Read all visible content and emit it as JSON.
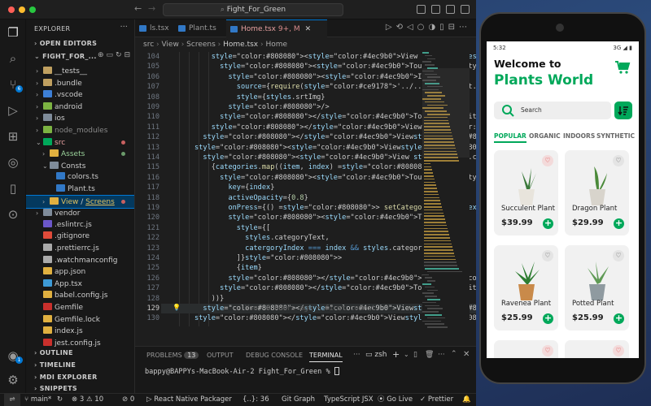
{
  "vscode": {
    "title_search": "Fight_For_Green",
    "explorer_label": "EXPLORER",
    "open_editors": "OPEN EDITORS",
    "project": "FIGHT_FOR_...",
    "tree": [
      {
        "label": "__tests__",
        "depth": 1,
        "chev": "›",
        "color": "#c0a060"
      },
      {
        "label": ".bundle",
        "depth": 1,
        "chev": "›",
        "color": "#c0a060"
      },
      {
        "label": ".vscode",
        "depth": 1,
        "chev": "›",
        "color": "#3d7fd6"
      },
      {
        "label": "android",
        "depth": 1,
        "chev": "›",
        "color": "#7cb342"
      },
      {
        "label": "ios",
        "depth": 1,
        "chev": "›",
        "color": "#7f8c9a"
      },
      {
        "label": "node_modules",
        "depth": 1,
        "chev": "›",
        "color": "#7cb342",
        "dim": true
      },
      {
        "label": "src",
        "depth": 1,
        "chev": "⌄",
        "color": "#00a85a",
        "dot": "#c96060",
        "labelcolor": "#e6a0a0"
      },
      {
        "label": "Assets",
        "depth": 2,
        "chev": "›",
        "color": "#e0b040",
        "dot": "#6a9a6a",
        "labelcolor": "#9ad29a"
      },
      {
        "label": "Consts",
        "depth": 2,
        "chev": "⌄",
        "color": "#7f8c9a"
      },
      {
        "label": "colors.ts",
        "depth": 3,
        "chev": "",
        "color": "#3178c6"
      },
      {
        "label": "Plant.ts",
        "depth": 3,
        "chev": "",
        "color": "#3178c6"
      },
      {
        "label": "View / Screens",
        "depth": 2,
        "chev": "›",
        "color": "#e0b040",
        "dot": "#c96060",
        "selected": true
      },
      {
        "label": "vendor",
        "depth": 1,
        "chev": "›",
        "color": "#7f8c9a"
      },
      {
        "label": ".eslintrc.js",
        "depth": 1,
        "chev": "",
        "color": "#6b57c9"
      },
      {
        "label": ".gitignore",
        "depth": 1,
        "chev": "",
        "color": "#e04b3a"
      },
      {
        "label": ".prettierrc.js",
        "depth": 1,
        "chev": "",
        "color": "#aaaaaa"
      },
      {
        "label": ".watchmanconfig",
        "depth": 1,
        "chev": "",
        "color": "#aaaaaa"
      },
      {
        "label": "app.json",
        "depth": 1,
        "chev": "",
        "color": "#e0b040"
      },
      {
        "label": "App.tsx",
        "depth": 1,
        "chev": "",
        "color": "#3d9ad6"
      },
      {
        "label": "babel.config.js",
        "depth": 1,
        "chev": "",
        "color": "#e0b040"
      },
      {
        "label": "Gemfile",
        "depth": 1,
        "chev": "",
        "color": "#c9302c"
      },
      {
        "label": "Gemfile.lock",
        "depth": 1,
        "chev": "",
        "color": "#e0b040"
      },
      {
        "label": "index.js",
        "depth": 1,
        "chev": "",
        "color": "#e0b040"
      },
      {
        "label": "jest.config.js",
        "depth": 1,
        "chev": "",
        "color": "#c9302c"
      }
    ],
    "outline": "OUTLINE",
    "timeline": "TIMELINE",
    "mdi": "MDI EXPLORER",
    "snippets": "SNIPPETS",
    "tabs": [
      {
        "label": "ls.tsx",
        "active": false
      },
      {
        "label": "Plant.ts",
        "active": false
      },
      {
        "label": "Home.tsx",
        "active": true,
        "badge": "9+, M"
      }
    ],
    "breadcrumb": [
      "src",
      "View",
      "Screens",
      "Home.tsx",
      "Home"
    ],
    "code": [
      {
        "n": "104",
        "t": "          <View style={styles.sortBtn}>"
      },
      {
        "n": "105",
        "t": "            <TouchableOpacity>"
      },
      {
        "n": "106",
        "t": "              <Image"
      },
      {
        "n": "107",
        "t": "                source={require('../../Assets/sort.png')}"
      },
      {
        "n": "108",
        "t": "                style={styles.srtImg}"
      },
      {
        "n": "109",
        "t": "              />"
      },
      {
        "n": "110",
        "t": "            </TouchableOpacity>"
      },
      {
        "n": "111",
        "t": "          </View>"
      },
      {
        "n": "112",
        "t": "        </View>"
      },
      {
        "n": "113",
        "t": "      <View>"
      },
      {
        "n": "114",
        "t": "        <View style={styles.categoryContainer}>"
      },
      {
        "n": "115",
        "t": "          {categories.map((item, index) => ("
      },
      {
        "n": "116",
        "t": "            <TouchableOpacity"
      },
      {
        "n": "117",
        "t": "              key={index}"
      },
      {
        "n": "118",
        "t": "              activeOpacity={0.8}"
      },
      {
        "n": "119",
        "t": "              onPress={() => setCategoryIndex(index)}>"
      },
      {
        "n": "120",
        "t": "              <Text"
      },
      {
        "n": "121",
        "t": "                style={["
      },
      {
        "n": "122",
        "t": "                  styles.categoryText,"
      },
      {
        "n": "123",
        "t": "                  catergoryIndex === index && styles.categoryTextSe"
      },
      {
        "n": "124",
        "t": "                ]}>"
      },
      {
        "n": "125",
        "t": "                {item}"
      },
      {
        "n": "126",
        "t": "              </Text>"
      },
      {
        "n": "127",
        "t": "            </TouchableOpacity>"
      },
      {
        "n": "128",
        "t": "          ))}"
      },
      {
        "n": "129",
        "t": "        </View>",
        "blame": "You, 8 hours ago • first commit"
      },
      {
        "n": "130",
        "t": "      </View>"
      }
    ],
    "panel_tabs": [
      {
        "label": "PROBLEMS",
        "badge": "13"
      },
      {
        "label": "OUTPUT"
      },
      {
        "label": "DEBUG CONSOLE"
      },
      {
        "label": "TERMINAL",
        "active": true
      }
    ],
    "terminal_shell": "zsh",
    "terminal_line": "bappy@BAPPYs-MacBook-Air-2 Fight_For_Green % ",
    "status": {
      "branch": "main*",
      "errors": "3",
      "warnings": "10",
      "ports": "0",
      "packager": "React Native Packager",
      "position": "{..}: 36",
      "gitgraph": "Git Graph",
      "lang": "TypeScript JSX",
      "golive": "Go Live",
      "prettier": "Prettier"
    }
  },
  "phone": {
    "time": "5:32",
    "signal": "3G",
    "welcome": "Welcome to",
    "title": "Plants World",
    "search_placeholder": "Search",
    "categories": [
      "POPULAR",
      "ORGANIC",
      "INDOORS",
      "SYNTHETIC"
    ],
    "products": [
      {
        "name": "Succulent Plant",
        "price": "$39.99",
        "liked": true
      },
      {
        "name": "Dragon Plant",
        "price": "$29.99",
        "liked": false
      },
      {
        "name": "Ravenea Plant",
        "price": "$25.99",
        "liked": false
      },
      {
        "name": "Potted Plant",
        "price": "$25.99",
        "liked": false
      }
    ],
    "accent": "#00a85a"
  }
}
